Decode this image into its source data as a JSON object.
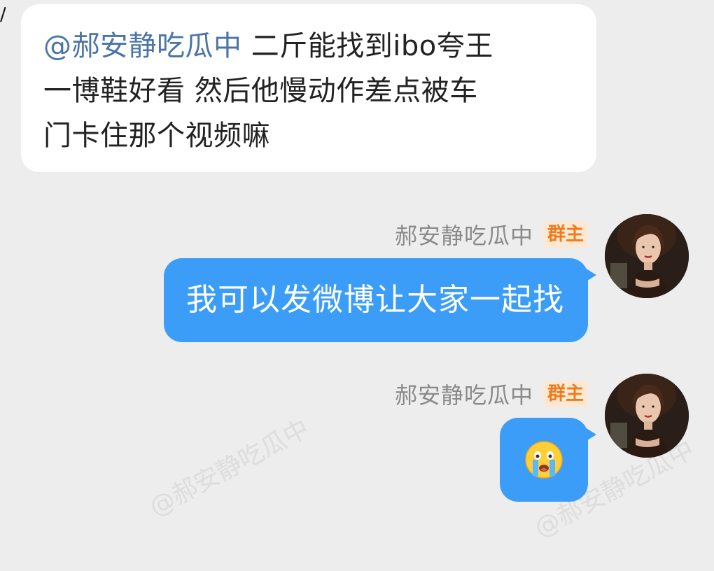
{
  "messages": [
    {
      "direction": "incoming",
      "mention": "@郝安静吃瓜中",
      "line1": " 二斤能找到ibo夸王",
      "line2": "一博鞋好看 然后他慢动作差点被车",
      "line3": "门卡住那个视频嘛"
    },
    {
      "direction": "outgoing",
      "sender": "郝安静吃瓜中",
      "badge": "群主",
      "text": "我可以发微博让大家一起找"
    },
    {
      "direction": "outgoing",
      "sender": "郝安静吃瓜中",
      "badge": "群主",
      "emoji": "crying-face"
    }
  ],
  "watermark": "@郝安静吃瓜中",
  "colors": {
    "background": "#ededed",
    "incoming_bubble": "#ffffff",
    "outgoing_bubble": "#3b9df8",
    "mention": "#4a75a6",
    "badge_text": "#f07a1a",
    "badge_bg": "#fde8d4"
  }
}
